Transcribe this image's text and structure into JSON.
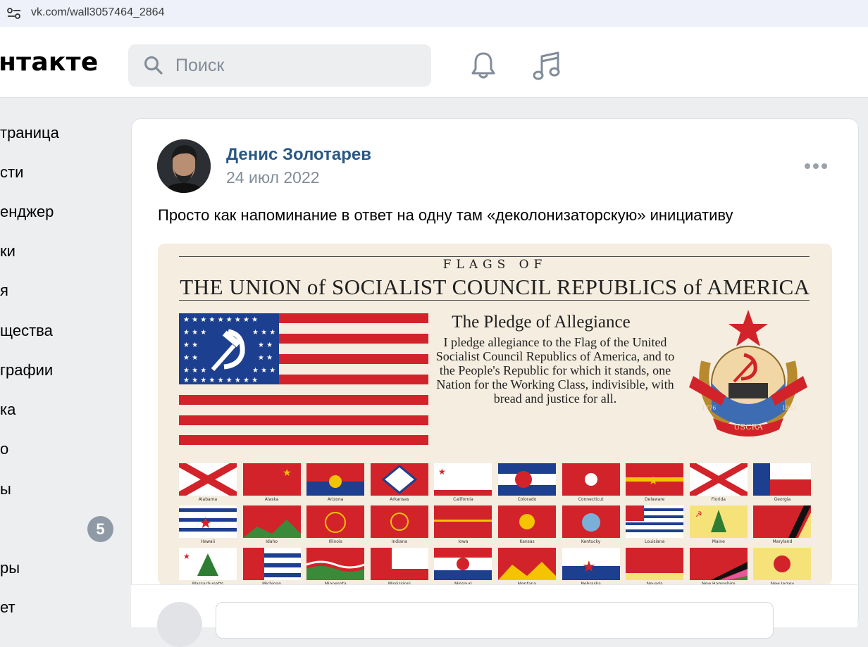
{
  "browser": {
    "url": "vk.com/wall3057464_2864"
  },
  "header": {
    "logo": "нтакте",
    "search_placeholder": "Поиск"
  },
  "sidebar": {
    "items": [
      "траница",
      "сти",
      "енджер",
      "ки",
      "я",
      "щества",
      "графии",
      "ка",
      "о",
      "ы",
      "",
      "ры",
      "ет"
    ],
    "badge": "5"
  },
  "post": {
    "author": "Денис Золотарев",
    "date": "24 июл 2022",
    "text": "Просто как напоминание в ответ на одну там «деколонизаторскую» инициативу",
    "image": {
      "kicker": "FLAGS OF",
      "title": "THE UNION of SOCIALIST COUNCIL REPUBLICS of AMERICA",
      "pledge_title": "The Pledge of Allegiance",
      "pledge_body": "I pledge allegiance to the Flag of the United Socialist Council Republics of America, and to the People's Republic for which it stands, one Nation for the Working Class, indivisible, with bread and justice for all.",
      "emblem_text": "USCRA",
      "emblem_years": [
        "1776",
        "1933"
      ],
      "state_flags": [
        "Alabama",
        "Alaska",
        "Arizona",
        "Arkansas",
        "California",
        "Colorado",
        "Connecticut",
        "Delaware",
        "Florida",
        "Georgia",
        "Hawaii",
        "Idaho",
        "Illinois",
        "Indiana",
        "Iowa",
        "Kansas",
        "Kentucky",
        "Louisiana",
        "Maine",
        "Maryland",
        "Massachusetts",
        "Michigan",
        "Minnesota",
        "Mississippi",
        "Missouri",
        "Montana",
        "Nebraska",
        "Nevada",
        "New Hampshire",
        "New Jersey"
      ]
    }
  },
  "colors": {
    "link": "#2a5885",
    "muted": "#818c99",
    "badge": "#8f9aa6",
    "red": "#d2232a",
    "blue": "#1d3f8f"
  }
}
